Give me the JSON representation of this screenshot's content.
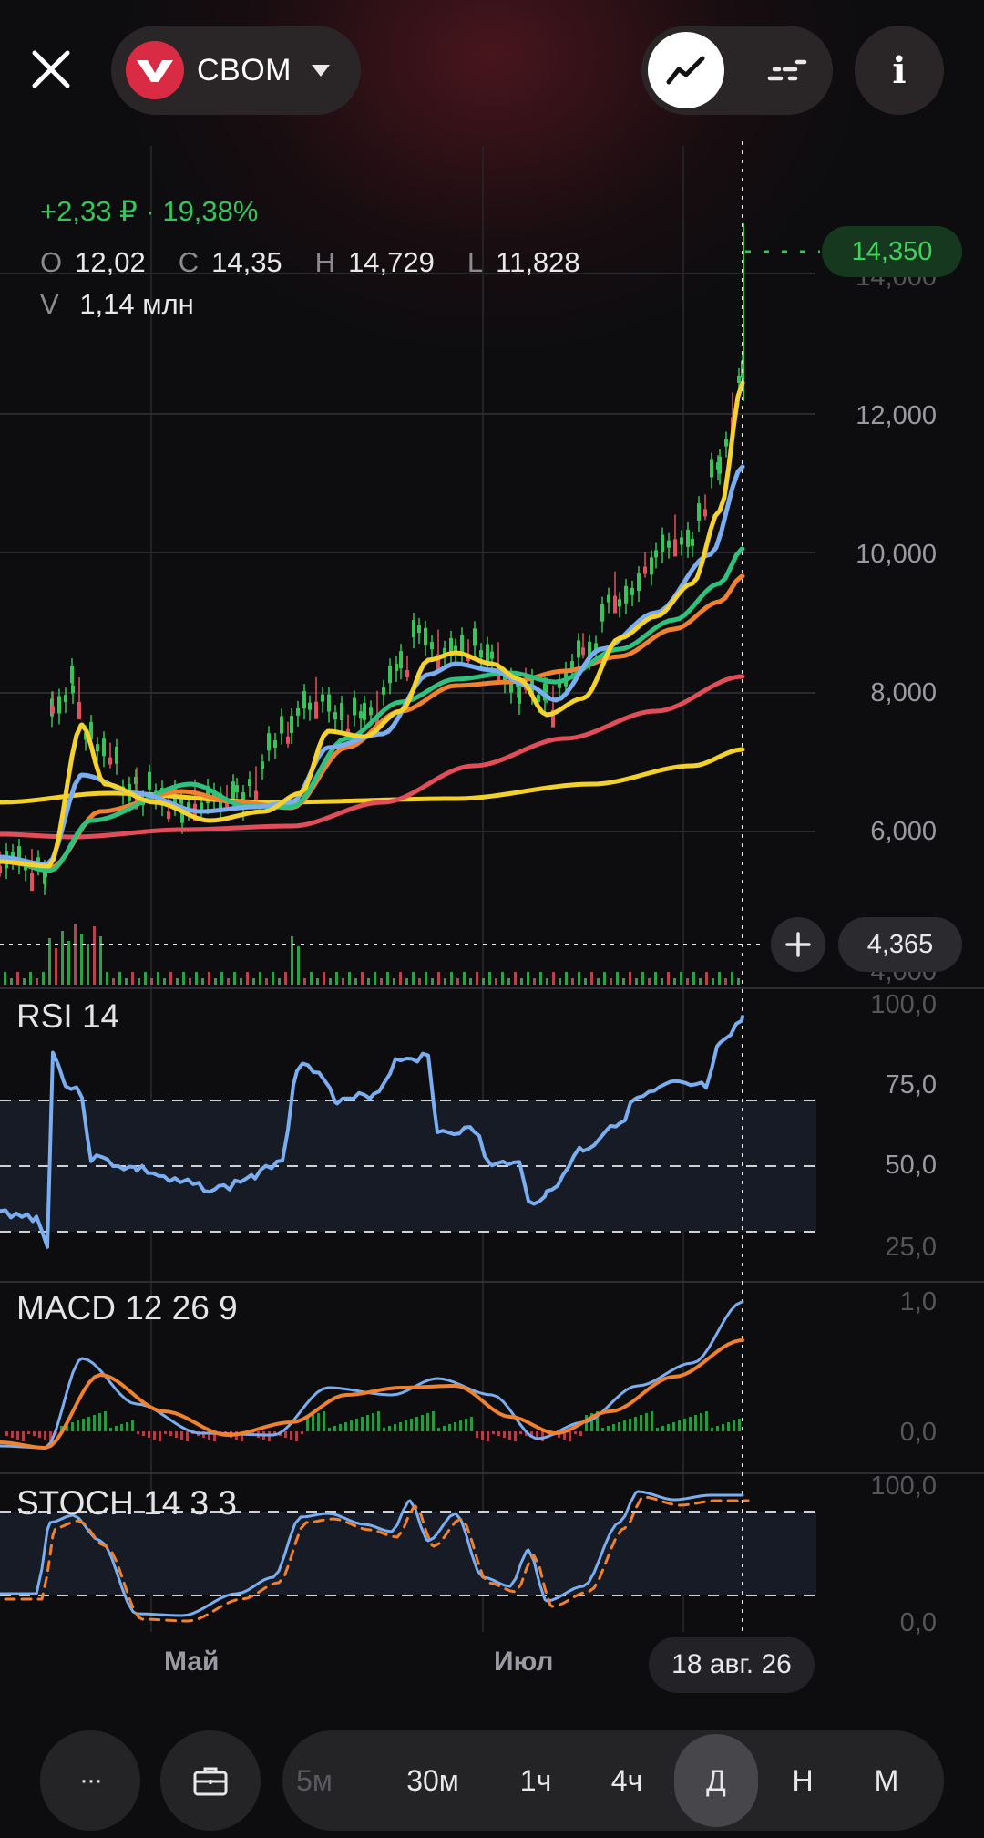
{
  "header": {
    "ticker": "CBOM",
    "icons": [
      "close-icon",
      "chevron-down-icon",
      "line-chart-icon",
      "candles-icon",
      "info-icon"
    ],
    "info_label": "i"
  },
  "quote": {
    "change": "+2,33 ₽ · 19,38%",
    "open_label": "O",
    "open": "12,02",
    "close_label": "C",
    "close": "14,35",
    "high_label": "H",
    "high": "14,729",
    "low_label": "L",
    "low": "11,828",
    "volume_label": "V",
    "volume": "1,14 млн"
  },
  "price_axis": {
    "last_price": "14,350",
    "crosshair_price": "4,365",
    "ticks": [
      "14,000",
      "12,000",
      "10,000",
      "8,000",
      "6,000",
      "4,000"
    ]
  },
  "indicators": {
    "rsi": {
      "title": "RSI 14",
      "ticks": [
        "100,0",
        "75,0",
        "50,0",
        "25,0"
      ]
    },
    "macd": {
      "title": "MACD 12 26 9",
      "ticks": [
        "1,0",
        "0,0"
      ]
    },
    "stoch": {
      "title": "STOCH 14 3 3",
      "ticks": [
        "100,0",
        "0,0"
      ]
    }
  },
  "time_axis": {
    "months": [
      "Май",
      "Июл"
    ],
    "cursor_date": "18 авг. 26"
  },
  "timeframes": {
    "more_label": "···",
    "items": [
      "5м",
      "30м",
      "1ч",
      "4ч",
      "Д",
      "Н",
      "М"
    ],
    "active": "Д"
  },
  "colors": {
    "up": "#35c55a",
    "down": "#e0525f",
    "ma_yellow": "#f5d22e",
    "ma_blue": "#7aaef0",
    "ma_green": "#2ec27e",
    "ma_orange": "#f0812e",
    "ma_red": "#e24d5a",
    "ma_long": "#f2d12c",
    "rsi": "#7aaef0",
    "macd_signal": "#f0812e"
  }
}
